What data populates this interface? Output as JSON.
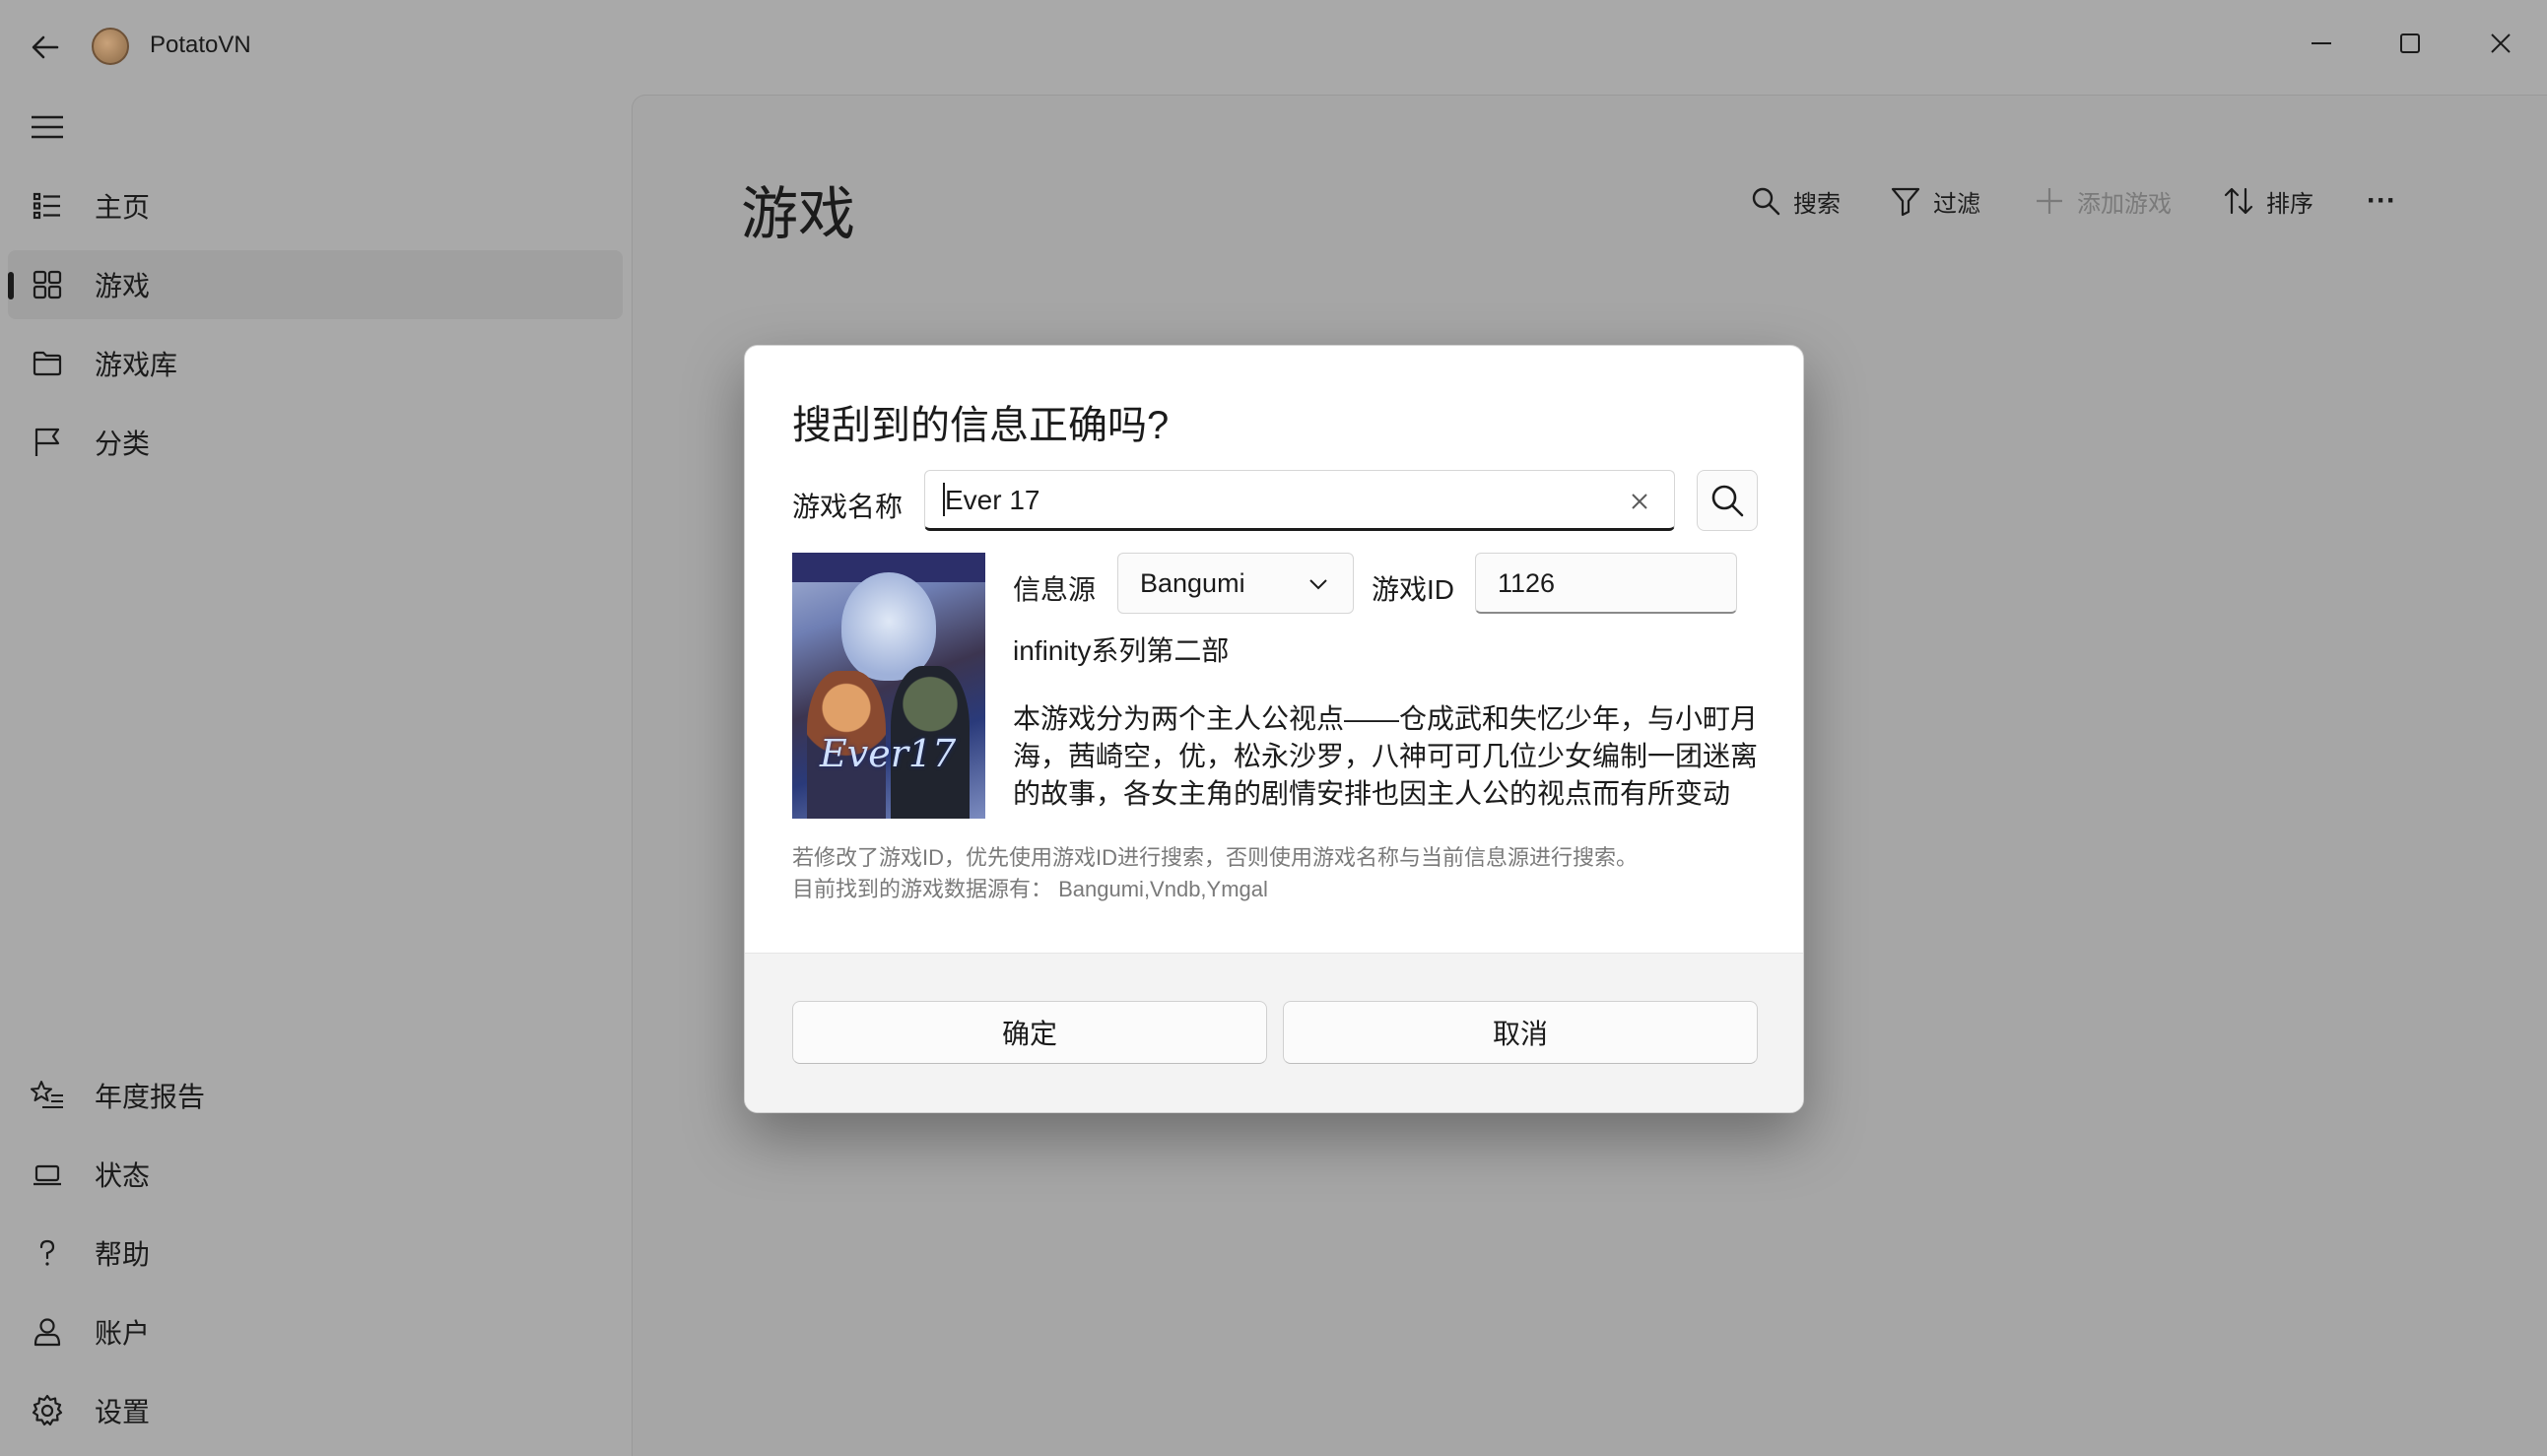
{
  "app": {
    "title": "PotatoVN",
    "back_icon": "back-arrow-icon",
    "window_controls": [
      "minimize-icon",
      "maximize-icon",
      "close-icon"
    ]
  },
  "sidebar": {
    "menu_icon": "hamburger-icon",
    "items": [
      {
        "label": "主页",
        "icon": "list-icon",
        "selected": false
      },
      {
        "label": "游戏",
        "icon": "grid-icon",
        "selected": true
      },
      {
        "label": "游戏库",
        "icon": "folder-icon",
        "selected": false
      },
      {
        "label": "分类",
        "icon": "flag-icon",
        "selected": false
      }
    ],
    "footer_items": [
      {
        "label": "年度报告",
        "icon": "star-list-icon"
      },
      {
        "label": "状态",
        "icon": "laptop-icon"
      },
      {
        "label": "帮助",
        "icon": "help-icon"
      },
      {
        "label": "账户",
        "icon": "person-icon"
      },
      {
        "label": "设置",
        "icon": "gear-icon"
      }
    ]
  },
  "page": {
    "title": "游戏",
    "commands": {
      "search": "搜索",
      "filter": "过滤",
      "add_game": "添加游戏",
      "sort": "排序",
      "more": "···"
    }
  },
  "dialog": {
    "title": "搜刮到的信息正确吗?",
    "name_label": "游戏名称",
    "name_value": "Ever 17",
    "source_label": "信息源",
    "source_value": "Bangumi",
    "id_label": "游戏ID",
    "id_value": "1126",
    "subtitle": "infinity系列第二部",
    "description": "本游戏分为两个主人公视点——仓成武和失忆少年，与小町月海，茜崎空，优，松永沙罗，八神可可几位少女编制一团迷离的故事，各女主角的剧情安排也因主人公的视点而有所变动",
    "hint_line1": "若修改了游戏ID，优先使用游戏ID进行搜索，否则使用游戏名称与当前信息源进行搜索。",
    "hint_line2": "目前找到的游戏数据源有： Bangumi,Vndb,Ymgal",
    "confirm": "确定",
    "cancel": "取消",
    "cover_logo": "Ever17"
  },
  "colors": {
    "overlay_bg": "#a9a9a9",
    "dialog_bg": "#ffffff",
    "text": "#1b1b1b",
    "hint_text": "#7a7a7a"
  }
}
